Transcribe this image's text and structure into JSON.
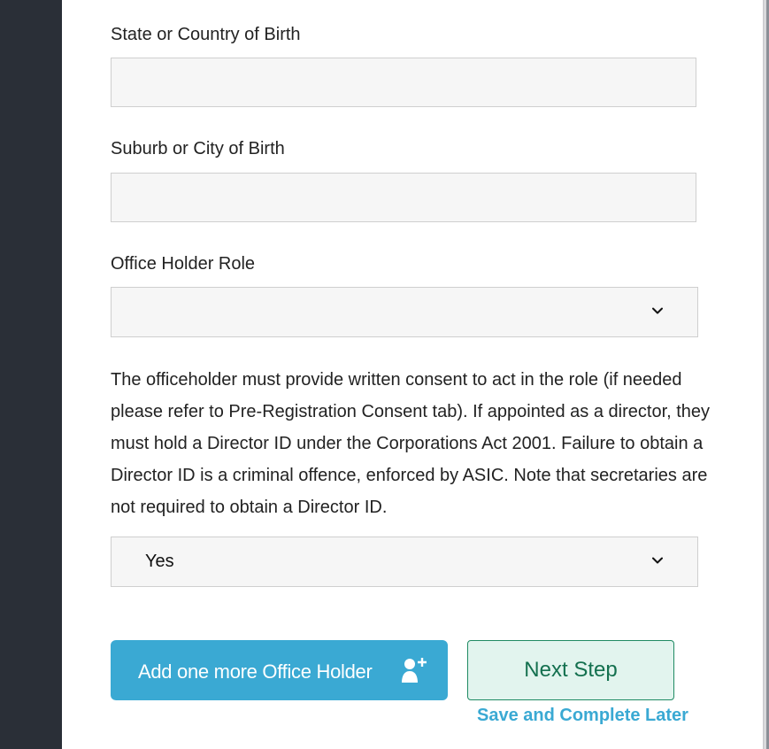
{
  "form": {
    "state_label": "State or Country of Birth",
    "state_value": "",
    "suburb_label": "Suburb or City of Birth",
    "suburb_value": "",
    "role_label": "Office Holder Role",
    "role_value": "",
    "notice": "The officeholder must provide written consent to act in the role (if needed please refer to Pre-Registration Consent tab). If appointed as a director, they must hold a Director ID under the Corporations Act 2001. Failure to obtain a Director ID is a criminal offence, enforced by ASIC. Note that secretaries are not required to obtain a Director ID.",
    "consent_value": "Yes"
  },
  "actions": {
    "add_holder_label": "Add one more Office Holder",
    "next_label": "Next Step",
    "save_later_label": "Save and Complete Later"
  },
  "colors": {
    "sidebar": "#2a2f37",
    "field_bg": "#f6f6f6",
    "add_button": "#3aa9d3",
    "next_button_bg": "#e2f4ee",
    "next_button_text": "#14704f",
    "link": "#3aa9d3"
  },
  "icons": {
    "select_chevron": "chevron-down-icon",
    "add_person": "add-person-icon"
  }
}
